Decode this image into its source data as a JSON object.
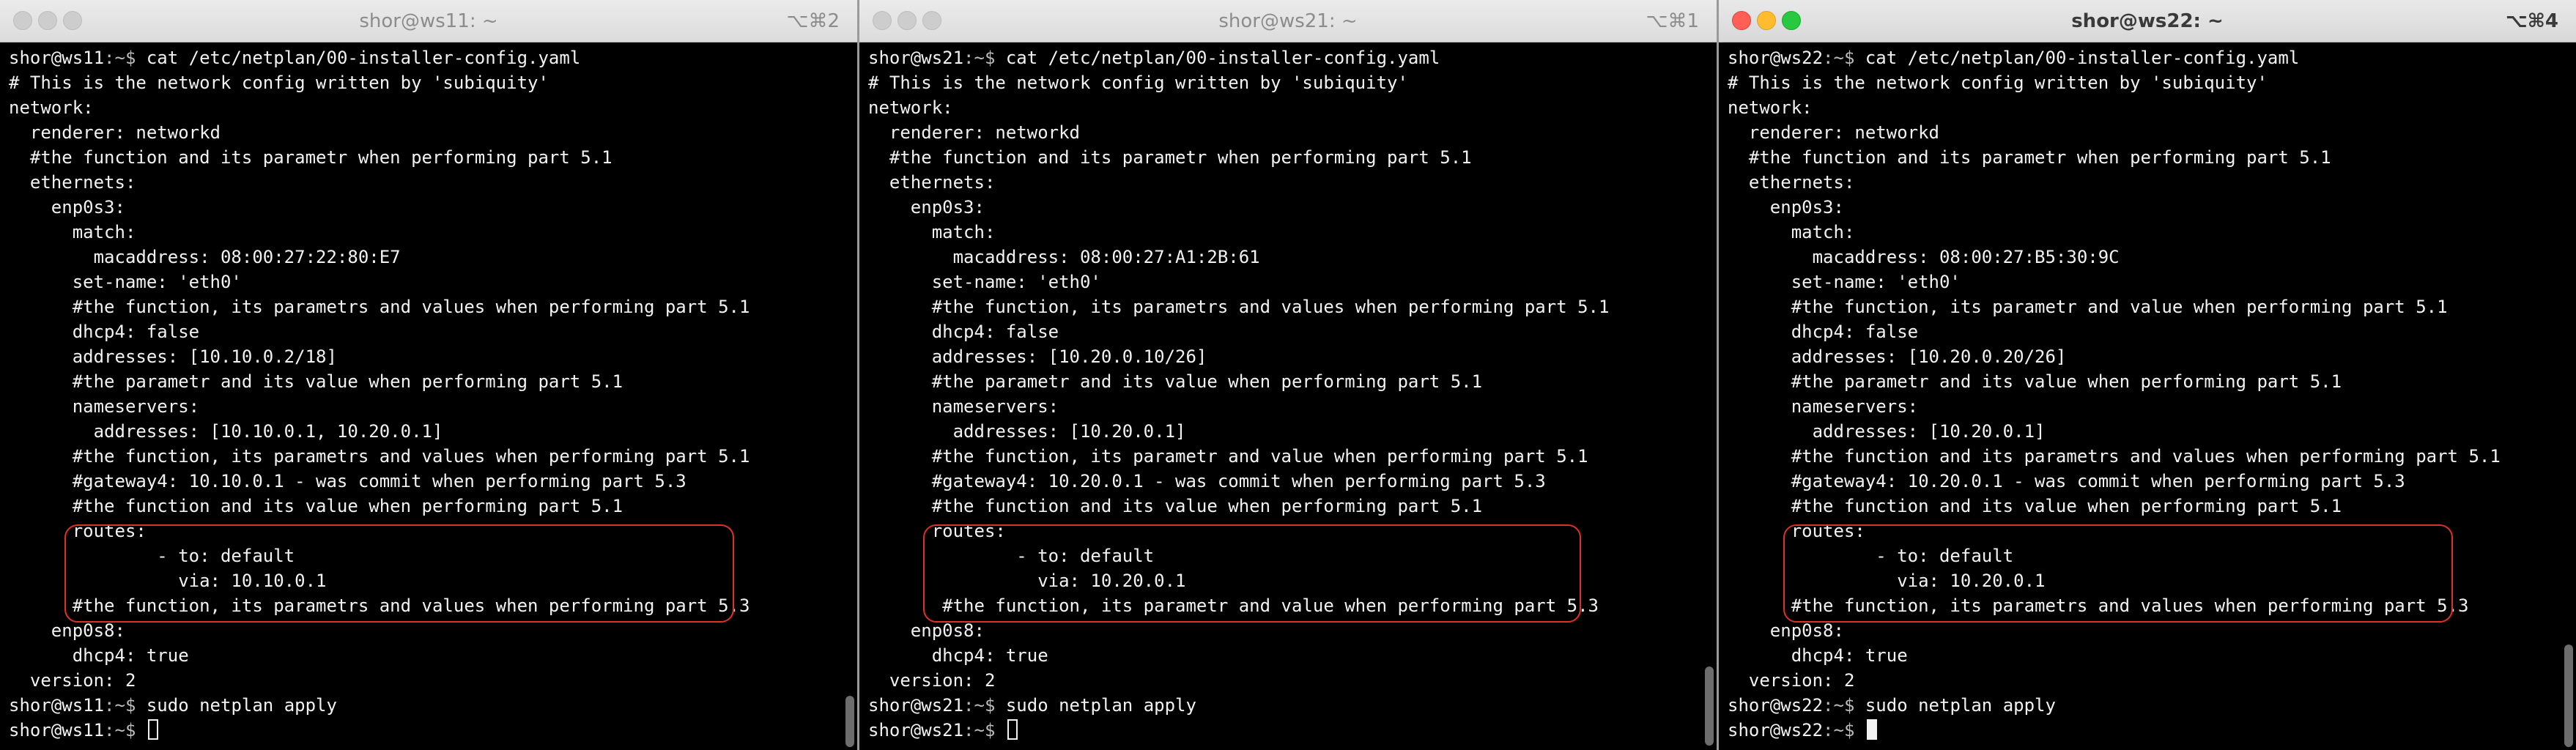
{
  "windows": [
    {
      "title": "shor@ws11: ~",
      "shortcut": "⌥⌘2",
      "active": false,
      "prompt_user": "shor@ws11",
      "prompt_path": ":~$",
      "command": " cat /etc/netplan/00-installer-config.yaml",
      "lines": [
        "# This is the network config written by 'subiquity'",
        "network:",
        "  renderer: networkd",
        "  #the function and its parametr when performing part 5.1",
        "  ethernets:",
        "    enp0s3:",
        "      match:",
        "        macaddress: 08:00:27:22:80:E7",
        "      set-name: 'eth0'",
        "      #the function, its parametrs and values when performing part 5.1",
        "      dhcp4: false",
        "      addresses: [10.10.0.2/18]",
        "      #the parametr and its value when performing part 5.1",
        "      nameservers:",
        "        addresses: [10.10.0.1, 10.20.0.1]",
        "      #the function, its parametrs and values when performing part 5.1",
        "      #gateway4: 10.10.0.1 - was commit when performing part 5.3",
        "      #the function and its value when performing part 5.1",
        "      routes:",
        "              - to: default",
        "                via: 10.10.0.1",
        "      #the function, its parametrs and values when performing part 5.3",
        "    enp0s8:",
        "      dhcp4: true",
        "  version: 2"
      ],
      "command2": " sudo netplan apply"
    },
    {
      "title": "shor@ws21: ~",
      "shortcut": "⌥⌘1",
      "active": false,
      "prompt_user": "shor@ws21",
      "prompt_path": ":~$",
      "command": " cat /etc/netplan/00-installer-config.yaml",
      "lines": [
        "# This is the network config written by 'subiquity'",
        "network:",
        "  renderer: networkd",
        "  #the function and its parametr when performing part 5.1",
        "  ethernets:",
        "    enp0s3:",
        "      match:",
        "        macaddress: 08:00:27:A1:2B:61",
        "      set-name: 'eth0'",
        "      #the function, its parametrs and values when performing part 5.1",
        "      dhcp4: false",
        "      addresses: [10.20.0.10/26]",
        "      #the parametr and its value when performing part 5.1",
        "      nameservers:",
        "        addresses: [10.20.0.1]",
        "      #the function, its parametr and value when performing part 5.1",
        "      #gateway4: 10.20.0.1 - was commit when performing part 5.3",
        "      #the function and its value when performing part 5.1",
        "      routes:",
        "              - to: default",
        "                via: 10.20.0.1",
        "       #the function, its parametr and value when performing part 5.3",
        "    enp0s8:",
        "      dhcp4: true",
        "  version: 2"
      ],
      "command2": " sudo netplan apply"
    },
    {
      "title": "shor@ws22: ~",
      "shortcut": "⌥⌘4",
      "active": true,
      "prompt_user": "shor@ws22",
      "prompt_path": ":~$",
      "command": " cat /etc/netplan/00-installer-config.yaml",
      "lines": [
        "# This is the network config written by 'subiquity'",
        "network:",
        "  renderer: networkd",
        "  #the function and its parametr when performing part 5.1",
        "  ethernets:",
        "    enp0s3:",
        "      match:",
        "        macaddress: 08:00:27:B5:30:9C",
        "      set-name: 'eth0'",
        "      #the function, its parametr and value when performing part 5.1",
        "      dhcp4: false",
        "      addresses: [10.20.0.20/26]",
        "      #the parametr and its value when performing part 5.1",
        "      nameservers:",
        "        addresses: [10.20.0.1]",
        "      #the function and its parametrs and values when performing part 5.1",
        "      #gateway4: 10.20.0.1 - was commit when performing part 5.3",
        "      #the function and its value when performing part 5.1",
        "      routes:",
        "              - to: default",
        "                via: 10.20.0.1",
        "      #the function, its parametrs and values when performing part 5.3",
        "    enp0s8:",
        "      dhcp4: true",
        "  version: 2"
      ],
      "command2": " sudo netplan apply"
    }
  ]
}
